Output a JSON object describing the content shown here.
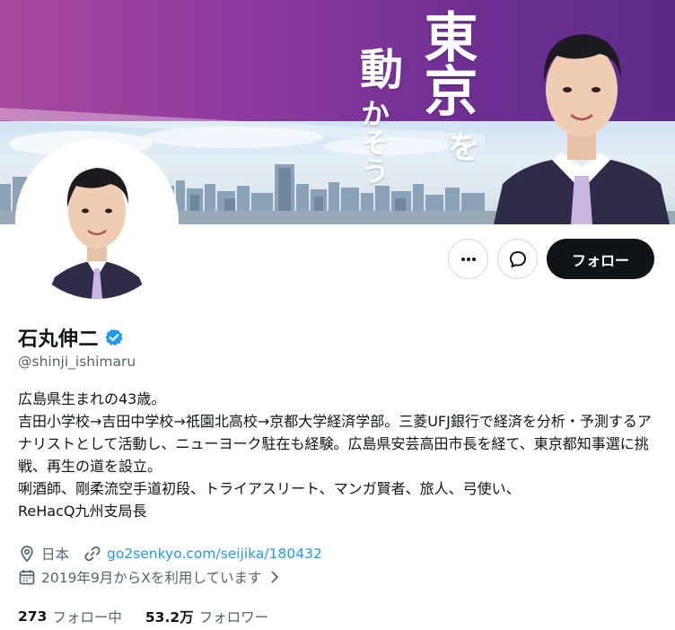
{
  "banner": {
    "text_tokyo": "東京",
    "text_ugo": "動",
    "text_kana": "かそう",
    "text_wo": "を",
    "colors": {
      "gradient_start": "#a8489c",
      "gradient_end": "#5d2a88"
    }
  },
  "actions": {
    "more_icon": "more-horizontal-icon",
    "message_icon": "message-bubble-icon",
    "follow_label": "フォロー"
  },
  "profile": {
    "name": "石丸伸二",
    "verified_icon": "verified-badge-icon",
    "handle": "@shinji_ishimaru",
    "bio": "広島県生まれの43歳。\n吉田小学校→吉田中学校→祇園北高校→京都大学経済学部。三菱UFJ銀行で経済を分析・予測するアナリストとして活動し、ニューヨーク駐在も経験。広島県安芸高田市長を経て、東京都知事選に挑戦、再生の道を設立。\n唎酒師、剛柔流空手道初段、トライアスリート、マンガ賢者、旅人、弓使い、\nReHacQ九州支局長",
    "location_icon": "location-pin-icon",
    "location": "日本",
    "link_icon": "link-icon",
    "link": "go2senkyo.com/seijika/180432",
    "joined_icon": "calendar-icon",
    "joined": "2019年9月からXを利用しています",
    "joined_chevron": "chevron-right-icon"
  },
  "stats": {
    "following_count": "273",
    "following_label": "フォロー中",
    "followers_count": "53.2万",
    "followers_label": "フォロワー"
  },
  "colors": {
    "accent": "#1d9bf0",
    "text_primary": "#0f1419",
    "text_secondary": "#536471",
    "follow_bg": "#0f1419"
  }
}
